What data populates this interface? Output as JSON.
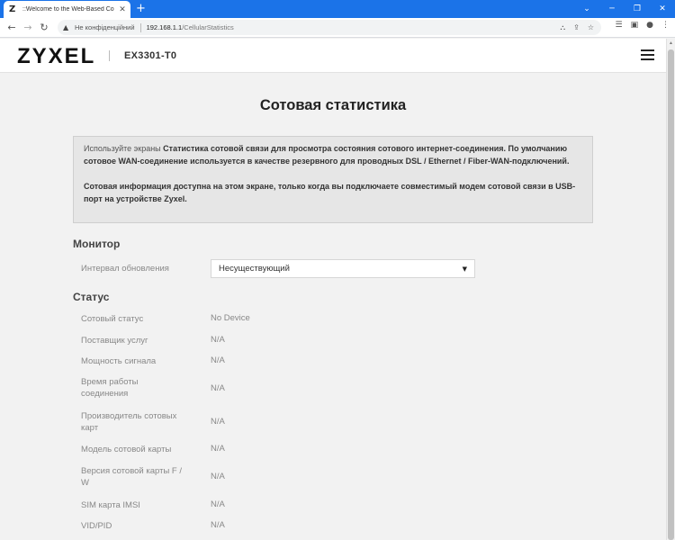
{
  "browser": {
    "tab_title": "::Welcome to the Web-Based Co",
    "favicon": "Z",
    "close": "✕",
    "new_tab": "+",
    "security_text": "Не конфіденційний",
    "url_host": "192.168.1.1",
    "url_path": "/CellularStatistics",
    "icons": [
      "translate-icon",
      "share-icon",
      "star-icon",
      "reading-list-icon",
      "side-panel-icon",
      "profile-icon",
      "menu-icon"
    ],
    "accent": "#1b73e8"
  },
  "header": {
    "logo": "ZYXEL",
    "model": "EX3301-T0"
  },
  "page": {
    "title": "Сотовая статистика",
    "info": {
      "p1_pre": "Используйте экраны ",
      "p1_bold": "Статистика сотовой связи для просмотра состояния сотового интернет-соединения. По умолчанию сотовое WAN-соединение используется в качестве резервного для проводных DSL / Ethernet / Fiber-WAN-подключений.",
      "p2": "Сотовая информация доступна на этом экране, только когда вы подключаете совместимый модем сотовой связи в USB-порт на устройстве Zyxel."
    },
    "monitor": {
      "title": "Монитор",
      "interval_label": "Интервал обновления",
      "interval_value": "Несуществующий"
    },
    "status": {
      "title": "Статус",
      "rows": [
        {
          "label": "Сотовый статус",
          "value": "No Device"
        },
        {
          "label": "Поставщик услуг",
          "value": "N/A"
        },
        {
          "label": "Мощность сигнала",
          "value": "N/A"
        },
        {
          "label": "Время работы соединения",
          "value": "N/A"
        },
        {
          "label": "Производитель сотовых карт",
          "value": "N/A"
        },
        {
          "label": "Модель сотовой карты",
          "value": "N/A"
        },
        {
          "label": "Версия сотовой карты F / W",
          "value": "N/A"
        },
        {
          "label": "SIM карта IMSI",
          "value": "N/A"
        },
        {
          "label": "VID/PID",
          "value": "N/A"
        }
      ]
    }
  }
}
